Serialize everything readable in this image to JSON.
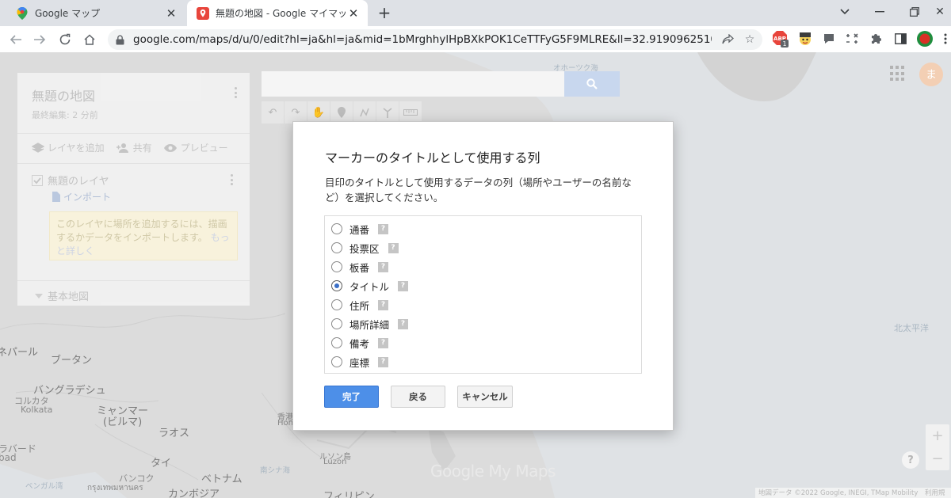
{
  "browser": {
    "tabs": [
      {
        "title": "Google マップ",
        "active": false
      },
      {
        "title": "無題の地図 - Google マイマップ",
        "active": true
      }
    ],
    "url": "google.com/maps/d/u/0/edit?hl=ja&hl=ja&mid=1bMrghhylHpBXkPOK1CeTTFyG5F9MLRE&ll=32.91909625105066%2C13...",
    "extension_badge": "1"
  },
  "panel": {
    "map_title": "無題の地図",
    "last_edit": "最終編集: 2 分前",
    "actions": {
      "add_layer": "レイヤを追加",
      "share": "共有",
      "preview": "プレビュー"
    },
    "layer_name": "無題のレイヤ",
    "import_label": "インポート",
    "hint_text": "このレイヤに場所を追加するには、描画するかデータをインポートします。",
    "hint_link": "もっと詳しく",
    "basemap_label": "基本地図"
  },
  "map": {
    "labels": [
      {
        "text": "オホーツク海",
        "kind": "sea"
      },
      {
        "text": "北太平洋",
        "kind": "sea"
      },
      {
        "text": "ネパール",
        "kind": "land"
      },
      {
        "text": "ブータン",
        "kind": "land"
      },
      {
        "text": "バングラデシュ",
        "kind": "big"
      },
      {
        "text": "コルカタ",
        "kind": "land"
      },
      {
        "text": "Kolkata",
        "kind": "land"
      },
      {
        "text": "ミャンマー",
        "kind": "big"
      },
      {
        "text": "(ビルマ)",
        "kind": "big"
      },
      {
        "text": "ラオス",
        "kind": "big"
      },
      {
        "text": "タイ",
        "kind": "big"
      },
      {
        "text": "ベトナム",
        "kind": "big"
      },
      {
        "text": "バンコク",
        "kind": "land"
      },
      {
        "text": "กรุงเทพมหานคร",
        "kind": "land"
      },
      {
        "text": "カンボジア",
        "kind": "big"
      },
      {
        "text": "ベンガル湾",
        "kind": "sea"
      },
      {
        "text": "南シナ海",
        "kind": "sea"
      },
      {
        "text": "フィリピン",
        "kind": "big"
      },
      {
        "text": "ルソン島",
        "kind": "land"
      },
      {
        "text": "Luzon",
        "kind": "land"
      },
      {
        "text": "香港",
        "kind": "land"
      },
      {
        "text": "Hon",
        "kind": "land"
      },
      {
        "text": "ラバード",
        "kind": "land"
      },
      {
        "text": "bad",
        "kind": "land"
      }
    ],
    "logo": "Google My Maps",
    "attribution": "地図データ ©2022 Google, INEGI, TMap Mobility　利用規",
    "avatar_letter": "ま"
  },
  "dialog": {
    "title": "マーカーのタイトルとして使用する列",
    "description": "目印のタイトルとして使用するデータの列（場所やユーザーの名前など）を選択してください。",
    "options": [
      {
        "label": "通番",
        "selected": false
      },
      {
        "label": "投票区",
        "selected": false
      },
      {
        "label": "板番",
        "selected": false
      },
      {
        "label": "タイトル",
        "selected": true
      },
      {
        "label": "住所",
        "selected": false
      },
      {
        "label": "場所詳細",
        "selected": false
      },
      {
        "label": "備考",
        "selected": false
      },
      {
        "label": "座標",
        "selected": false
      }
    ],
    "help_glyph": "?",
    "buttons": {
      "ok": "完了",
      "back": "戻る",
      "cancel": "キャンセル"
    }
  },
  "colors": {
    "primary_button": "#4d8fe8",
    "radio_selected": "#3b6fc7",
    "avatar": "#f3cfb4",
    "search_button": "#c8d7ee"
  }
}
